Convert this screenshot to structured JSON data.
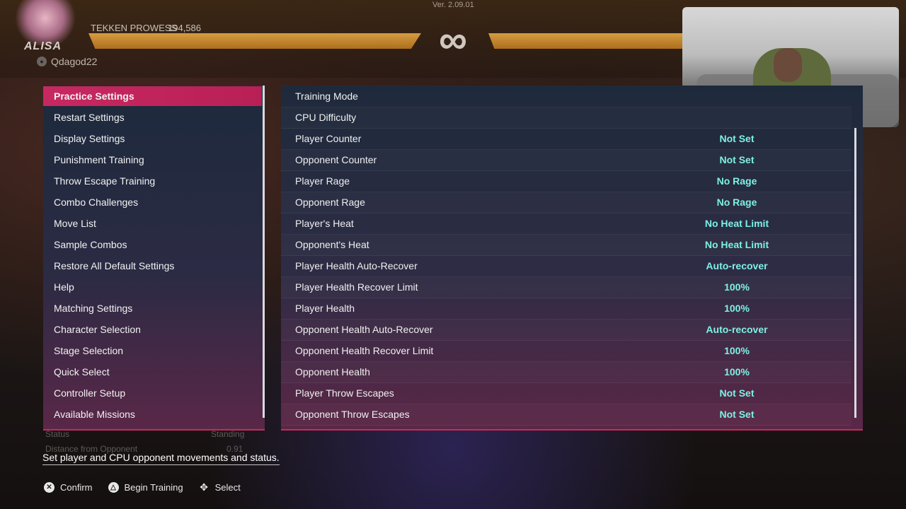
{
  "hud": {
    "version": "Ver. 2.09.01",
    "character_name": "ALISA",
    "prowess_label": "TEKKEN PROWESS",
    "prowess_value": "194,586",
    "player_id": "Qdagod22",
    "timer": "∞"
  },
  "left_menu": {
    "items": [
      {
        "label": "Practice Settings",
        "active": true
      },
      {
        "label": "Restart Settings"
      },
      {
        "label": "Display Settings"
      },
      {
        "label": "Punishment Training"
      },
      {
        "label": "Throw Escape Training"
      },
      {
        "label": "Combo Challenges"
      },
      {
        "label": "Move List"
      },
      {
        "label": "Sample Combos"
      },
      {
        "label": "Restore All Default Settings"
      },
      {
        "label": "Help"
      },
      {
        "label": "Matching Settings"
      },
      {
        "label": "Character Selection"
      },
      {
        "label": "Stage Selection"
      },
      {
        "label": "Quick Select"
      },
      {
        "label": "Controller Setup"
      },
      {
        "label": "Available Missions"
      }
    ]
  },
  "settings": {
    "rows": [
      {
        "label": "Training Mode",
        "value": ""
      },
      {
        "label": "CPU Difficulty",
        "value": ""
      },
      {
        "label": "Player Counter",
        "value": "Not Set"
      },
      {
        "label": "Opponent Counter",
        "value": "Not Set"
      },
      {
        "label": "Player Rage",
        "value": "No Rage"
      },
      {
        "label": "Opponent Rage",
        "value": "No Rage"
      },
      {
        "label": "Player's Heat",
        "value": "No Heat Limit"
      },
      {
        "label": "Opponent's Heat",
        "value": "No Heat Limit"
      },
      {
        "label": "Player Health Auto-Recover",
        "value": "Auto-recover"
      },
      {
        "label": "Player Health Recover Limit",
        "value": "100%"
      },
      {
        "label": "Player Health",
        "value": "100%"
      },
      {
        "label": "Opponent Health Auto-Recover",
        "value": "Auto-recover"
      },
      {
        "label": "Opponent Health Recover Limit",
        "value": "100%"
      },
      {
        "label": "Opponent Health",
        "value": "100%"
      },
      {
        "label": "Player Throw Escapes",
        "value": "Not Set"
      },
      {
        "label": "Opponent Throw Escapes",
        "value": "Not Set"
      }
    ]
  },
  "background_stats": {
    "status_label": "Status",
    "status_value": "Standing",
    "distance_label": "Distance from Opponent",
    "distance_value": "0.91"
  },
  "hint": "Set player and CPU opponent movements and status.",
  "controls": [
    {
      "icon": "cross-button-icon",
      "glyph": "✕",
      "label": "Confirm"
    },
    {
      "icon": "triangle-button-icon",
      "glyph": "△",
      "label": "Begin Training"
    },
    {
      "icon": "dpad-icon",
      "glyph": "✥",
      "label": "Select"
    }
  ],
  "colors": {
    "accent": "#c72860",
    "value_text": "#7ef0e4"
  }
}
